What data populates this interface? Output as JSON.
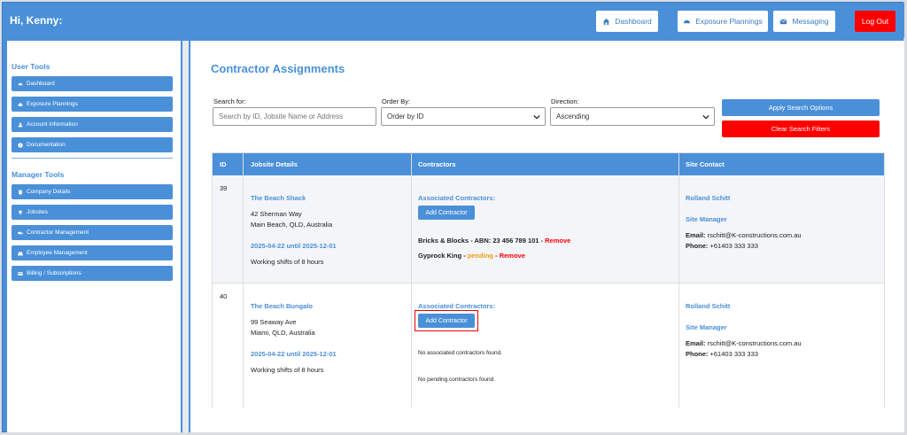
{
  "header": {
    "greeting": "Hi, Kenny:",
    "buttons": {
      "dashboard": "Dashboard",
      "exposure": "Exposure Plannings",
      "messaging": "Messaging",
      "logout": "Log Out"
    }
  },
  "sidebar": {
    "user_tools_heading": "User Tools",
    "user_items": [
      {
        "label": "Dashboard",
        "icon": "dashboard-icon"
      },
      {
        "label": "Exposure Plannings",
        "icon": "cloud-icon"
      },
      {
        "label": "Account Information",
        "icon": "user-icon"
      },
      {
        "label": "Documentation",
        "icon": "info-icon"
      }
    ],
    "manager_tools_heading": "Manager Tools",
    "manager_items": [
      {
        "label": "Company Details",
        "icon": "building-icon"
      },
      {
        "label": "Jobsites",
        "icon": "map-pin-icon"
      },
      {
        "label": "Contractor Management",
        "icon": "truck-icon"
      },
      {
        "label": "Employee Management",
        "icon": "users-icon"
      },
      {
        "label": "Billing / Subscriptions",
        "icon": "credit-card-icon"
      }
    ]
  },
  "main": {
    "title": "Contractor Assignments",
    "search": {
      "label": "Search for:",
      "placeholder": "Search by ID, Jobsite Name or Address",
      "order_label": "Order By:",
      "order_value": "Order by ID",
      "direction_label": "Direction:",
      "direction_value": "Ascending",
      "apply": "Apply Search Options",
      "clear": "Clear Search Filters"
    },
    "table": {
      "headers": [
        "ID",
        "Jobsite Details",
        "Contractors",
        "Site Contact"
      ],
      "rows": [
        {
          "id": "39",
          "jobsite_name": "The Beach Shack",
          "address1": "42 Sherman Way",
          "address2": "Main Beach, QLD, Australia",
          "dates": "2025-04-22 until 2025-12-01",
          "shifts": "Working shifts of 8 hours",
          "assoc_label": "Associated Contractors:",
          "add_btn": "Add Contractor",
          "contractor1": "Bricks & Blocks - ABN: 23 456 789 101 - ",
          "contractor1_action": "Remove",
          "contractor2": "Gyprock King - ",
          "contractor2_status": "pending",
          "contractor2_sep": " - ",
          "contractor2_action": "Remove",
          "contact_name": "Rolland Schitt",
          "contact_role": "Site Manager",
          "email_label": "Email:",
          "email": " rschitt@K-constructions.com.au",
          "phone_label": "Phone:",
          "phone": " +61403 333 333"
        },
        {
          "id": "40",
          "jobsite_name": "The Beach Bungalo",
          "address1": "99 Seaway Ave",
          "address2": "Miami, QLD, Australia",
          "dates": "2025-04-22 until 2025-12-01",
          "shifts": "Working shifts of 8 hours",
          "assoc_label": "Associated Contractors:",
          "add_btn": "Add Contractor",
          "no_assoc": "No associated contractors found.",
          "no_pending": "No pending contractors found.",
          "contact_name": "Rolland Schitt",
          "contact_role": "Site Manager",
          "email_label": "Email:",
          "email": " rschitt@K-constructions.com.au",
          "phone_label": "Phone:",
          "phone": " +61403 333 333"
        }
      ]
    }
  },
  "colors": {
    "primary": "#4a90d9",
    "danger": "#ff0000",
    "pending": "#f39c12"
  }
}
